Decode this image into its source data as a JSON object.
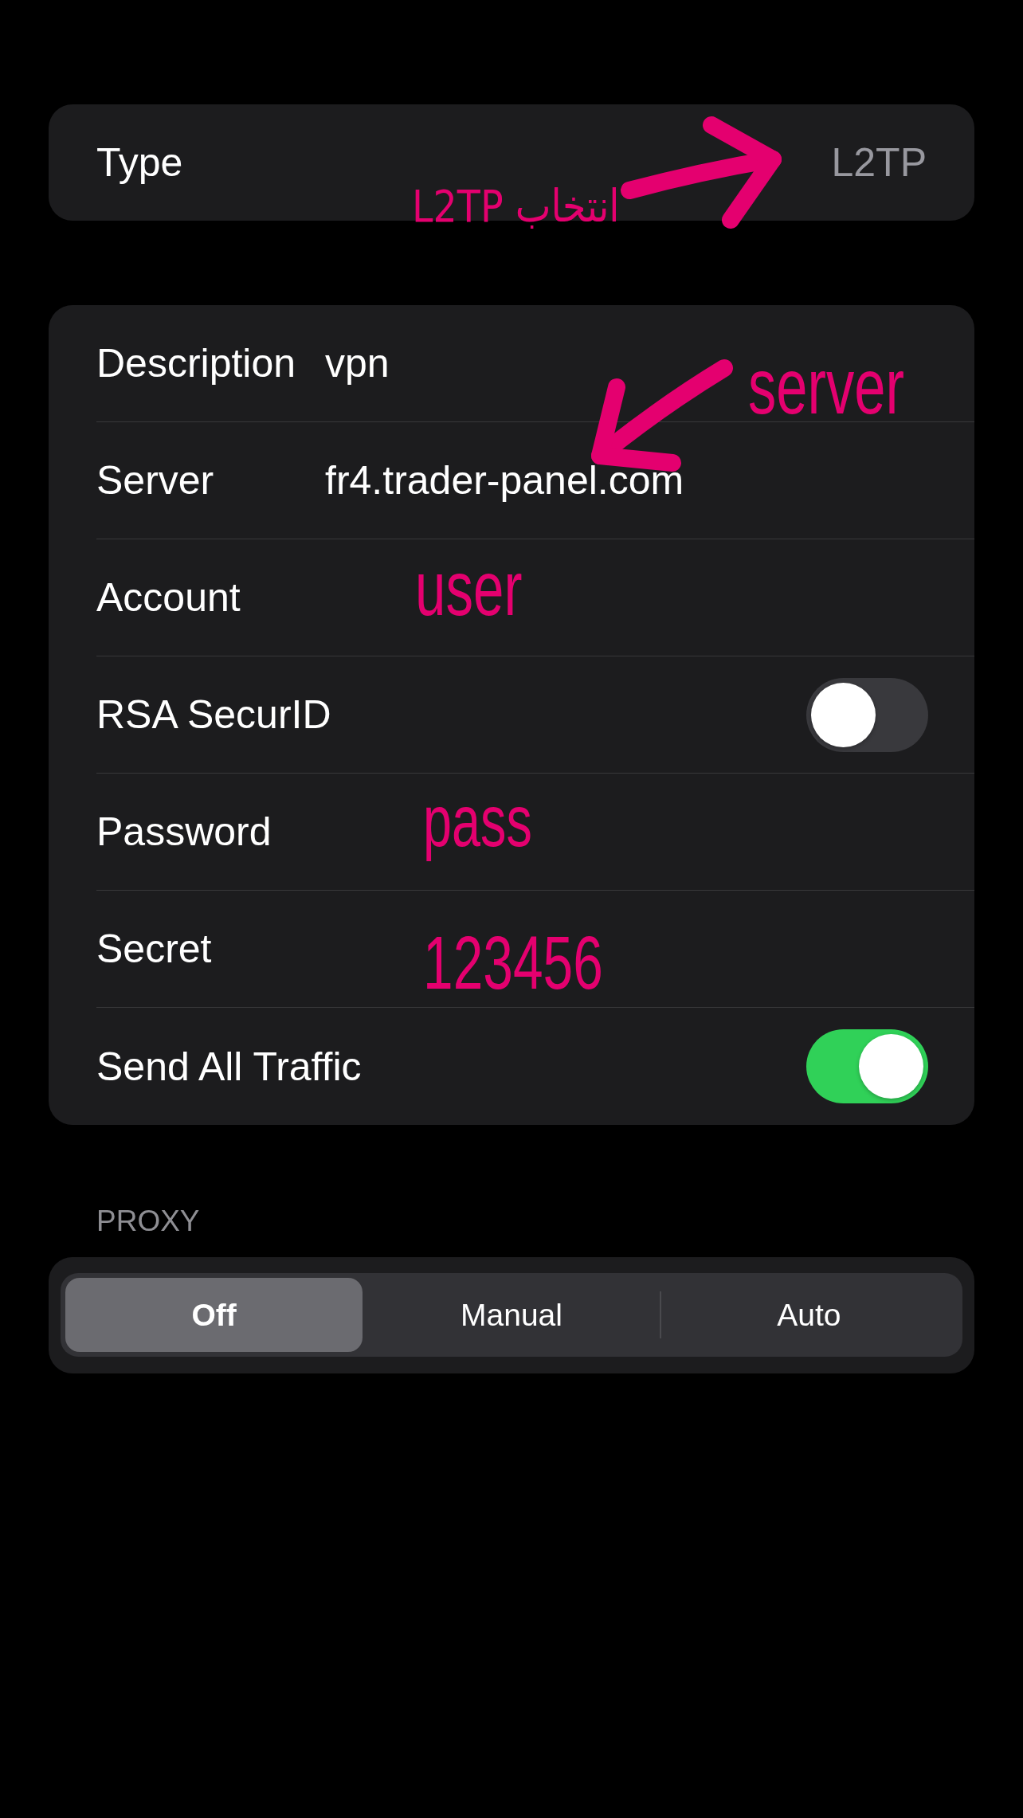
{
  "type_row": {
    "label": "Type",
    "value": "L2TP"
  },
  "settings": [
    {
      "kind": "text",
      "label": "Description",
      "value": "vpn"
    },
    {
      "kind": "text",
      "label": "Server",
      "value": "fr4.trader-panel.com"
    },
    {
      "kind": "text",
      "label": "Account"
    },
    {
      "kind": "toggle",
      "label": "RSA SecurID",
      "on": false
    },
    {
      "kind": "text",
      "label": "Password"
    },
    {
      "kind": "text",
      "label": "Secret"
    },
    {
      "kind": "toggle",
      "label": "Send All Traffic",
      "on": true
    }
  ],
  "proxy": {
    "header": "PROXY",
    "segments": [
      {
        "label": "Off",
        "selected": true
      },
      {
        "label": "Manual",
        "selected": false
      },
      {
        "label": "Auto",
        "selected": false
      }
    ]
  },
  "annotations": [
    "انتخاب L2TP",
    "server",
    "user",
    "pass",
    "123456"
  ]
}
